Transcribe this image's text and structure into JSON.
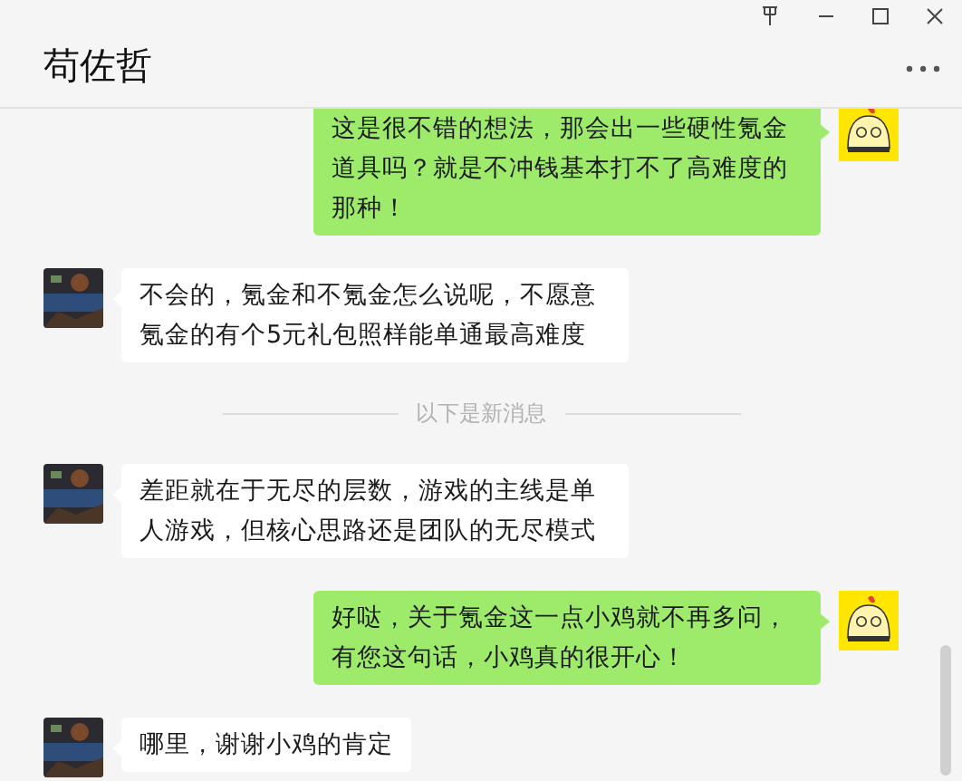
{
  "chat": {
    "title": "苟佐哲"
  },
  "messages": [
    {
      "kind": "message",
      "from_self": true,
      "text": "这是很不错的想法，那会出一些硬性氪金道具吗？就是不冲钱基本打不了高难度的那种！"
    },
    {
      "kind": "message",
      "from_self": false,
      "text": "不会的，氪金和不氪金怎么说呢，不愿意氪金的有个5元礼包照样能单通最高难度"
    },
    {
      "kind": "notice",
      "text": "以下是新消息"
    },
    {
      "kind": "message",
      "from_self": false,
      "text": "差距就在于无尽的层数，游戏的主线是单人游戏，但核心思路还是团队的无尽模式"
    },
    {
      "kind": "message",
      "from_self": true,
      "text": "好哒，关于氪金这一点小鸡就不再多问，有您这句话，小鸡真的很开心！"
    },
    {
      "kind": "message",
      "from_self": false,
      "text": "哪里，谢谢小鸡的肯定"
    }
  ]
}
